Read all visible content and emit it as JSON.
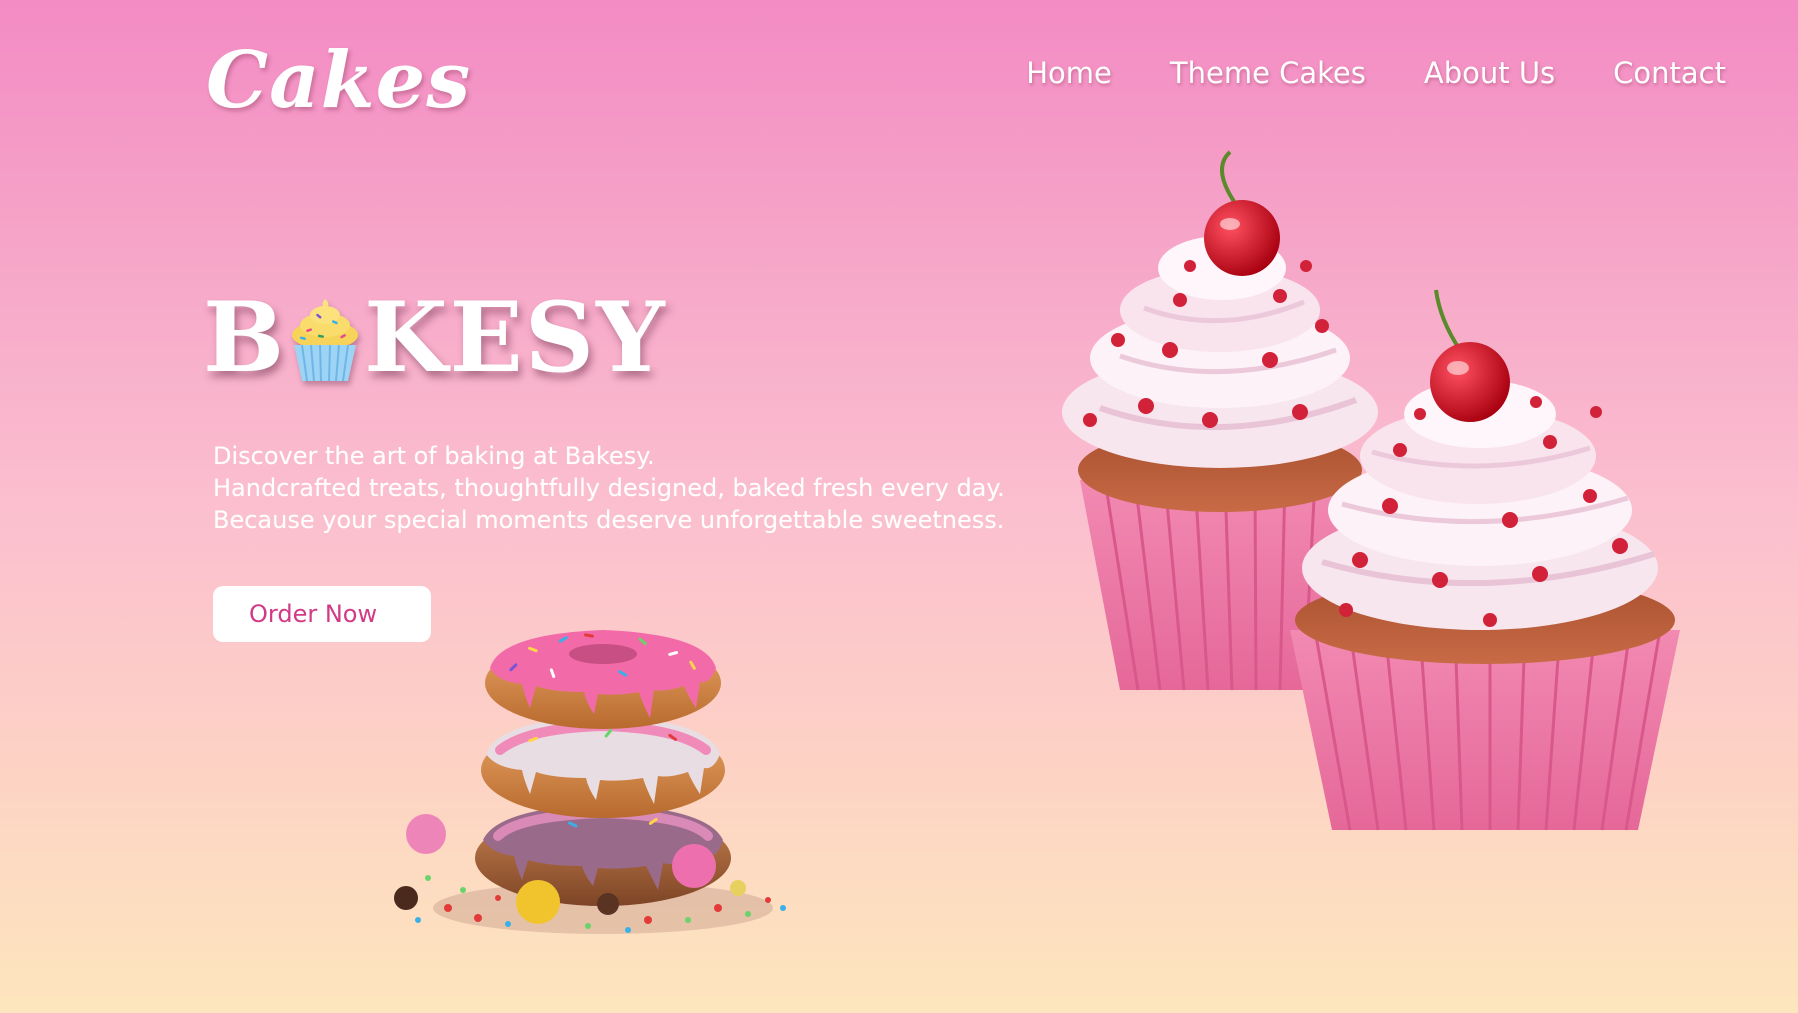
{
  "brand": {
    "logo_text": "Cakes"
  },
  "nav": {
    "items": [
      {
        "label": "Home"
      },
      {
        "label": "Theme Cakes"
      },
      {
        "label": "About Us"
      },
      {
        "label": "Contact"
      }
    ]
  },
  "hero": {
    "title_prefix": "B",
    "title_suffix": "KESY",
    "title_icon": "cupcake-icon",
    "lines": [
      "Discover the art of baking at Bakesy.",
      "Handcrafted treats, thoughtfully designed, baked fresh every day.",
      "Because your special moments deserve unforgettable sweetness."
    ],
    "cta_label": "Order Now"
  },
  "images": {
    "donuts": "stacked-donuts-image",
    "cupcakes": "cherry-cupcakes-image"
  },
  "colors": {
    "gradient_top": "#f38bc4",
    "gradient_bottom": "#fde6bd",
    "accent": "#d23a86",
    "text": "#ffffff"
  }
}
